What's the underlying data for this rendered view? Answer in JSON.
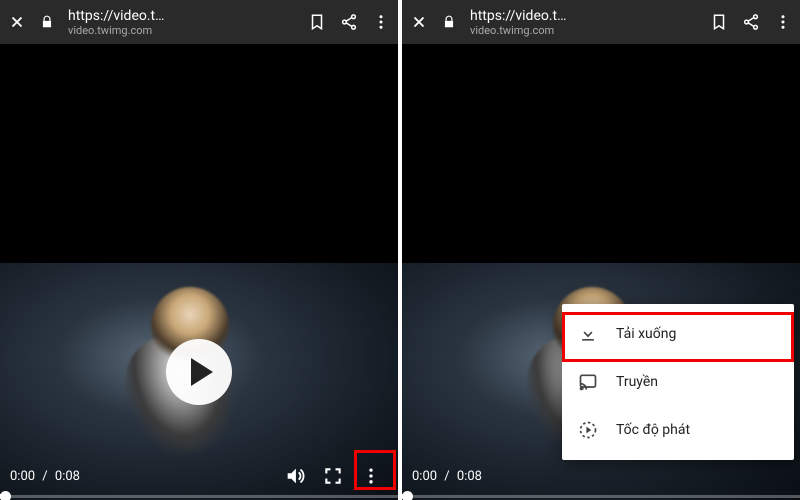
{
  "address": {
    "url_truncated": "https://video.t…",
    "host": "video.twimg.com"
  },
  "player": {
    "time_current": "0:00",
    "time_total": "0:08"
  },
  "menu": {
    "download": "Tải xuống",
    "cast": "Truyền",
    "speed": "Tốc độ phát"
  }
}
